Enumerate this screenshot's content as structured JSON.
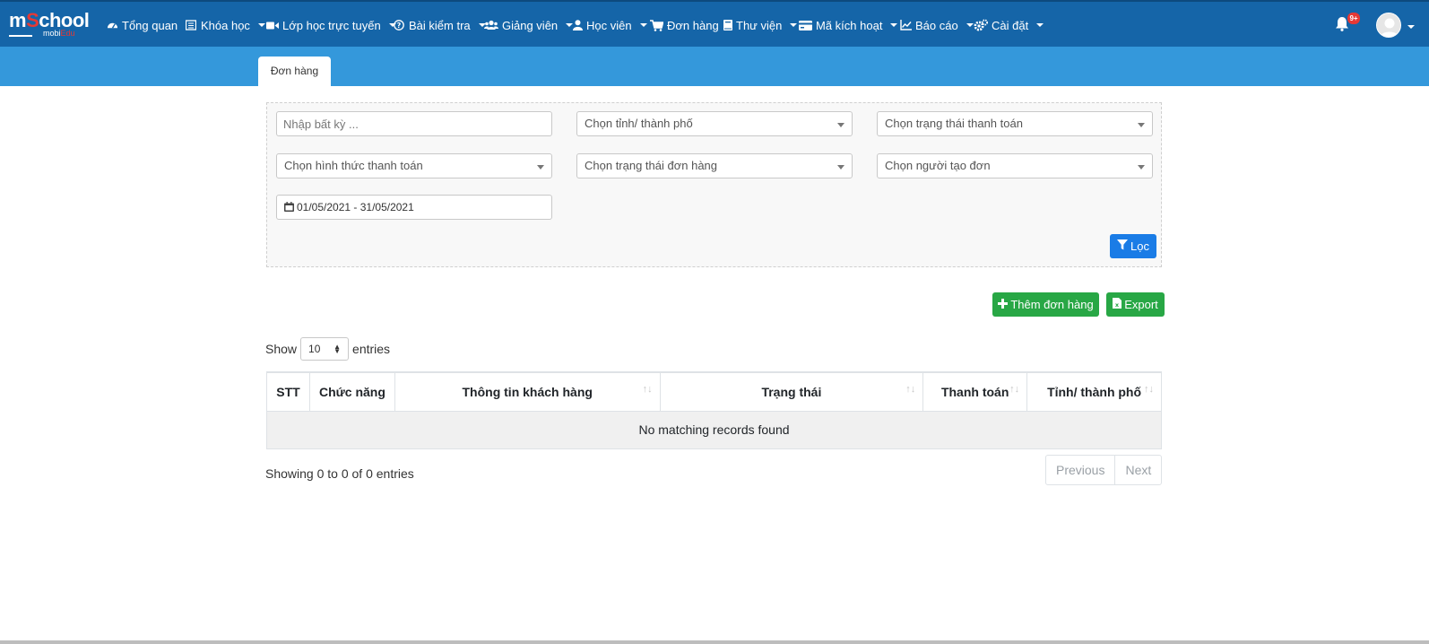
{
  "brand": {
    "logo_main_prefix": "m",
    "logo_main_accent": "S",
    "logo_main_suffix": "chool",
    "logo_sub_prefix": "mobi",
    "logo_sub_accent": "Edu"
  },
  "nav": [
    {
      "label": "Tổng quan",
      "icon": "dashboard-icon",
      "dropdown": false
    },
    {
      "label": "Khóa học",
      "icon": "list-icon",
      "dropdown": true
    },
    {
      "label": "Lớp học trực tuyến",
      "icon": "video-camera-icon",
      "dropdown": true
    },
    {
      "label": "Bài kiểm tra",
      "icon": "question-circle-icon",
      "dropdown": true
    },
    {
      "label": "Giảng viên",
      "icon": "users-icon",
      "dropdown": true
    },
    {
      "label": "Học viên",
      "icon": "user-icon",
      "dropdown": true
    },
    {
      "label": "Đơn hàng",
      "icon": "cart-icon",
      "dropdown": false
    },
    {
      "label": "Thư viện",
      "icon": "book-icon",
      "dropdown": true
    },
    {
      "label": "Mã kích hoạt",
      "icon": "credit-card-icon",
      "dropdown": true
    },
    {
      "label": "Báo cáo",
      "icon": "line-chart-icon",
      "dropdown": true
    },
    {
      "label": "Cài đặt",
      "icon": "cogs-icon",
      "dropdown": true
    }
  ],
  "notifications": {
    "badge": "9+"
  },
  "tab": {
    "label": "Đơn hàng"
  },
  "filters": {
    "search_placeholder": "Nhập bất kỳ ...",
    "province": "Chọn tỉnh/ thành phố",
    "payment_status": "Chọn trạng thái thanh toán",
    "payment_method": "Chọn hình thức thanh toán",
    "order_status": "Chọn trạng thái đơn hàng",
    "creator": "Chọn người tạo đơn",
    "date_range": "01/05/2021 - 31/05/2021",
    "filter_button": "Lọc"
  },
  "actions": {
    "add_order": "Thêm đơn hàng",
    "export": "Export"
  },
  "table": {
    "show_label": "Show",
    "entries_label": "entries",
    "page_length": "10",
    "columns": [
      "STT",
      "Chức năng",
      "Thông tin khách hàng",
      "Trạng thái",
      "Thanh toán",
      "Tỉnh/ thành phố"
    ],
    "empty_message": "No matching records found",
    "info": "Showing 0 to 0 of 0 entries",
    "prev": "Previous",
    "next": "Next"
  },
  "colors": {
    "navbar": "#1565a8",
    "subbar": "#3498db",
    "primary": "#1a7ce6",
    "success": "#28a745",
    "badge": "#e53935"
  }
}
